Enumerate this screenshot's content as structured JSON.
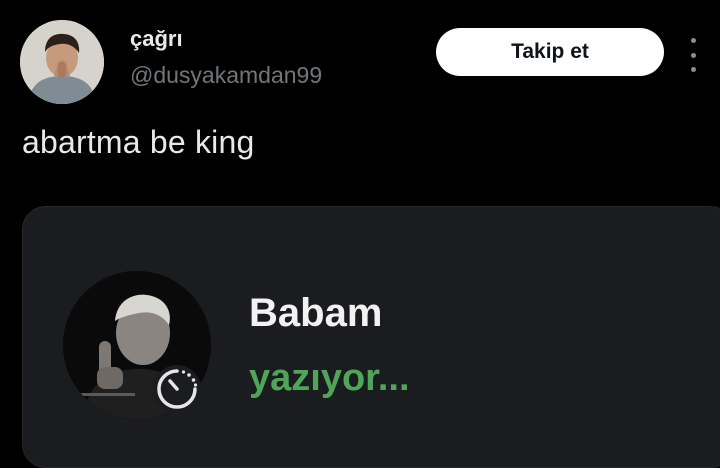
{
  "tweet": {
    "author": {
      "display_name": "çağrı",
      "handle": "@dusyakamdan99",
      "avatar_icon": "user-avatar-photo"
    },
    "follow_label": "Takip et",
    "more_icon": "more-vertical-icon",
    "text": "abartma be king"
  },
  "media": {
    "contact_name": "Babam",
    "status": "yazıyor...",
    "status_color": "#4fa658",
    "photo_icon": "contact-photo",
    "timer_icon": "disappearing-timer-icon"
  }
}
